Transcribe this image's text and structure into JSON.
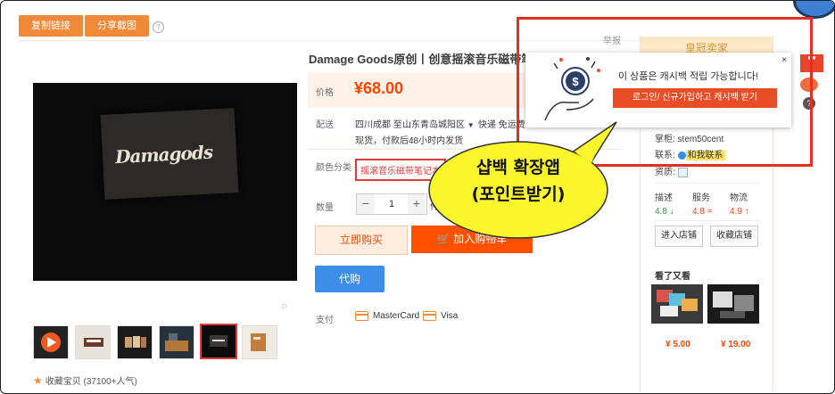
{
  "toolbar": {
    "copy_link": "复制链接",
    "share_screenshot": "分享截图"
  },
  "product": {
    "title": "Damage Goods原创丨创意摇滚音乐磁带笔记本",
    "price_label": "价格",
    "price": "¥68.00",
    "shipping_label": "配送",
    "ship_from": "四川成都 至",
    "ship_to": "山东青岛城阳区",
    "ship_method": "快递 免运费",
    "ship_note": "现货，付款后48小时内发货",
    "color_label": "颜色分类",
    "color_option": "摇滚音乐磁带笔记本",
    "qty_label": "数量",
    "qty_value": "1",
    "qty_unit": "件",
    "buy_now": "立即购买",
    "add_cart": "加入购物车",
    "proxy_buy": "代购",
    "pay_label": "支付",
    "pay_mastercard": "MasterCard",
    "pay_visa": "Visa",
    "card_brand": "Damagods",
    "favorite": "收藏宝贝 (37100+人气)"
  },
  "shop": {
    "report": "举报",
    "rank": "皇冠卖家",
    "keeper": "掌柜: stem50cent",
    "contact_label": "联系:",
    "contact_btn": "和我联系",
    "qualification_label": "资质:",
    "ratings": [
      {
        "label": "描述",
        "value": "4.8 ↓",
        "color": "#2ea043"
      },
      {
        "label": "服务",
        "value": "4.8 =",
        "color": "#ff4400"
      },
      {
        "label": "物流",
        "value": "4.9 ↑",
        "color": "#ff4400"
      }
    ],
    "enter_shop": "进入店铺",
    "fav_shop": "收藏店铺",
    "seen_title": "看了又看",
    "seen_prices": [
      "¥ 5.00",
      "¥ 19.00"
    ]
  },
  "popup": {
    "message": "이 상품은 캐시백 적립 가능합니다!",
    "button": "로그인/ 신규가입하고 캐시백 받기",
    "close": "×"
  },
  "annotation": {
    "line1": "샵백 확장앱",
    "line2": "(포인트받기)"
  },
  "colors": {
    "accent": "#f0893a",
    "price": "#ff4400",
    "overlay_red": "#e42e1e",
    "bubble": "#fbf52c"
  }
}
